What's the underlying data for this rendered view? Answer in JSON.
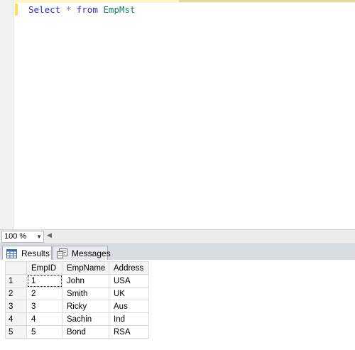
{
  "editor": {
    "query_tokens": {
      "kw_select": "Select",
      "star": "*",
      "kw_from": "from",
      "table": "EmpMst"
    }
  },
  "zoom": {
    "value": "100 %"
  },
  "tabs": [
    {
      "label": "Results",
      "icon": "grid-icon",
      "active": true
    },
    {
      "label": "Messages",
      "icon": "messages-icon",
      "active": false
    }
  ],
  "grid": {
    "columns": [
      "EmpID",
      "EmpName",
      "Address"
    ],
    "rows": [
      {
        "num": "1",
        "cells": [
          "1",
          "John",
          "USA"
        ]
      },
      {
        "num": "2",
        "cells": [
          "2",
          "Smith",
          "UK"
        ]
      },
      {
        "num": "3",
        "cells": [
          "3",
          "Ricky",
          "Aus"
        ]
      },
      {
        "num": "4",
        "cells": [
          "4",
          "Sachin",
          "Ind"
        ]
      },
      {
        "num": "5",
        "cells": [
          "5",
          "Bond",
          "RSA"
        ]
      }
    ]
  },
  "colors": {
    "keyword": "#2a2ad6",
    "identifier": "#14806e",
    "operator": "#808080",
    "change_marker": "#ffe25a"
  }
}
